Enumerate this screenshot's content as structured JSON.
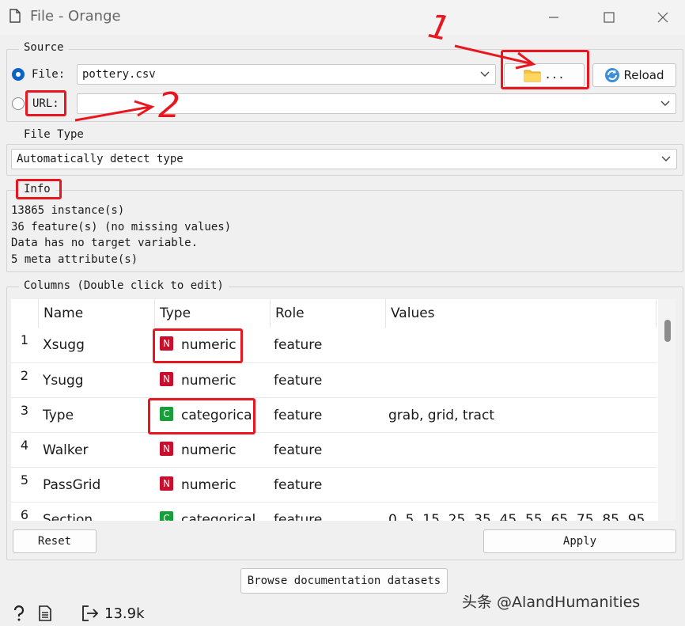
{
  "window": {
    "title": "File - Orange"
  },
  "source": {
    "label": "Source",
    "file_label": "File:",
    "file_value": "pottery.csv",
    "browse_label": "...",
    "reload_label": "Reload",
    "url_label": "URL:",
    "url_value": ""
  },
  "file_type": {
    "label": "File Type",
    "value": "Automatically detect type"
  },
  "info": {
    "label": "Info",
    "lines": [
      "13865 instance(s)",
      "36 feature(s) (no missing values)",
      "Data has no target variable.",
      "5 meta attribute(s)"
    ]
  },
  "columns": {
    "label": "Columns (Double click to edit)",
    "headers": [
      "Name",
      "Type",
      "Role",
      "Values"
    ],
    "rows": [
      {
        "num": "1",
        "name": "Xsugg",
        "type_letter": "N",
        "type": "numeric",
        "role": "feature",
        "values": ""
      },
      {
        "num": "2",
        "name": "Ysugg",
        "type_letter": "N",
        "type": "numeric",
        "role": "feature",
        "values": ""
      },
      {
        "num": "3",
        "name": "Type",
        "type_letter": "C",
        "type": "categorica",
        "role": "feature",
        "values": "grab, grid, tract"
      },
      {
        "num": "4",
        "name": "Walker",
        "type_letter": "N",
        "type": "numeric",
        "role": "feature",
        "values": ""
      },
      {
        "num": "5",
        "name": "PassGrid",
        "type_letter": "N",
        "type": "numeric",
        "role": "feature",
        "values": ""
      },
      {
        "num": "6",
        "name": "Section",
        "type_letter": "C",
        "type": "categorical",
        "role": "feature",
        "values": "0, 5, 15, 25, 35, 45, 55, 65, 75, 85, 95, S..."
      }
    ]
  },
  "buttons": {
    "reset": "Reset",
    "apply": "Apply",
    "browse_docs": "Browse documentation datasets"
  },
  "status": {
    "size": "13.9k"
  },
  "watermark": "头条 @AlandHumanities",
  "annotations": {
    "mark1": "1",
    "mark2": "2"
  },
  "colors": {
    "numeric_badge": "#c8102e",
    "categorical_badge": "#1a9e3b",
    "highlight": "#e8171f",
    "radio_selected": "#0a64c8"
  },
  "icons": [
    "document-icon",
    "minimize-icon",
    "maximize-icon",
    "close-icon",
    "folder-icon",
    "reload-icon",
    "help-icon",
    "report-icon",
    "output-icon",
    "chevron-down-icon"
  ]
}
